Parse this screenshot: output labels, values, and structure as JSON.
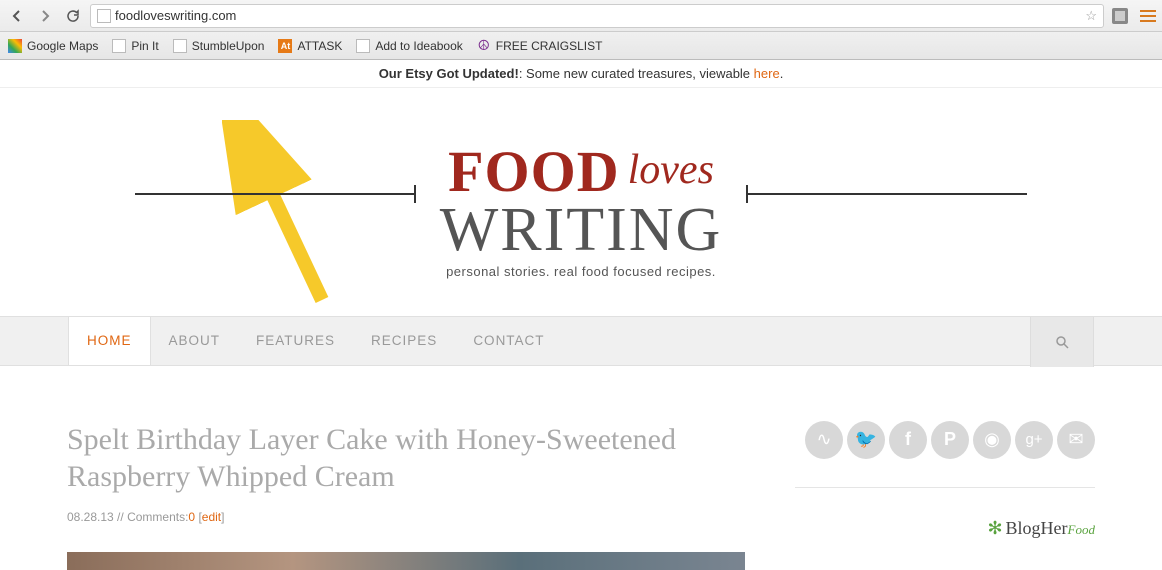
{
  "browser": {
    "url": "foodloveswriting.com",
    "bookmarks": [
      {
        "label": "Google Maps",
        "icon": "maps"
      },
      {
        "label": "Pin It",
        "icon": "page"
      },
      {
        "label": "StumbleUpon",
        "icon": "page"
      },
      {
        "label": "ATTASK",
        "icon": "attask",
        "icon_text": "At"
      },
      {
        "label": "Add to Ideabook",
        "icon": "page"
      },
      {
        "label": "FREE CRAIGSLIST",
        "icon": "peace",
        "icon_text": "☮"
      }
    ]
  },
  "announcement": {
    "bold": "Our Etsy Got Updated!",
    "text": ": Some new curated treasures, viewable ",
    "link_text": "here",
    "period": "."
  },
  "logo": {
    "food": "FOOD",
    "loves": "loves",
    "writing": "WRITING",
    "tagline": "personal stories. real food focused recipes."
  },
  "nav": {
    "items": [
      {
        "label": "HOME",
        "active": true
      },
      {
        "label": "ABOUT",
        "active": false
      },
      {
        "label": "FEATURES",
        "active": false
      },
      {
        "label": "RECIPES",
        "active": false
      },
      {
        "label": "CONTACT",
        "active": false
      }
    ]
  },
  "post": {
    "title": "Spelt Birthday Layer Cake with Honey-Sweetened Raspberry Whipped Cream",
    "date": "08.28.13",
    "sep": " // ",
    "comments_label": "Comments:",
    "comments_count": "0",
    "edit_open": " [",
    "edit_text": "edit",
    "edit_close": "]"
  },
  "sidebar": {
    "social": [
      "rss",
      "twitter",
      "facebook",
      "pinterest",
      "instagram",
      "gplus",
      "email"
    ],
    "blogher_prefix": "BlogHer",
    "blogher_suffix": "Food"
  }
}
